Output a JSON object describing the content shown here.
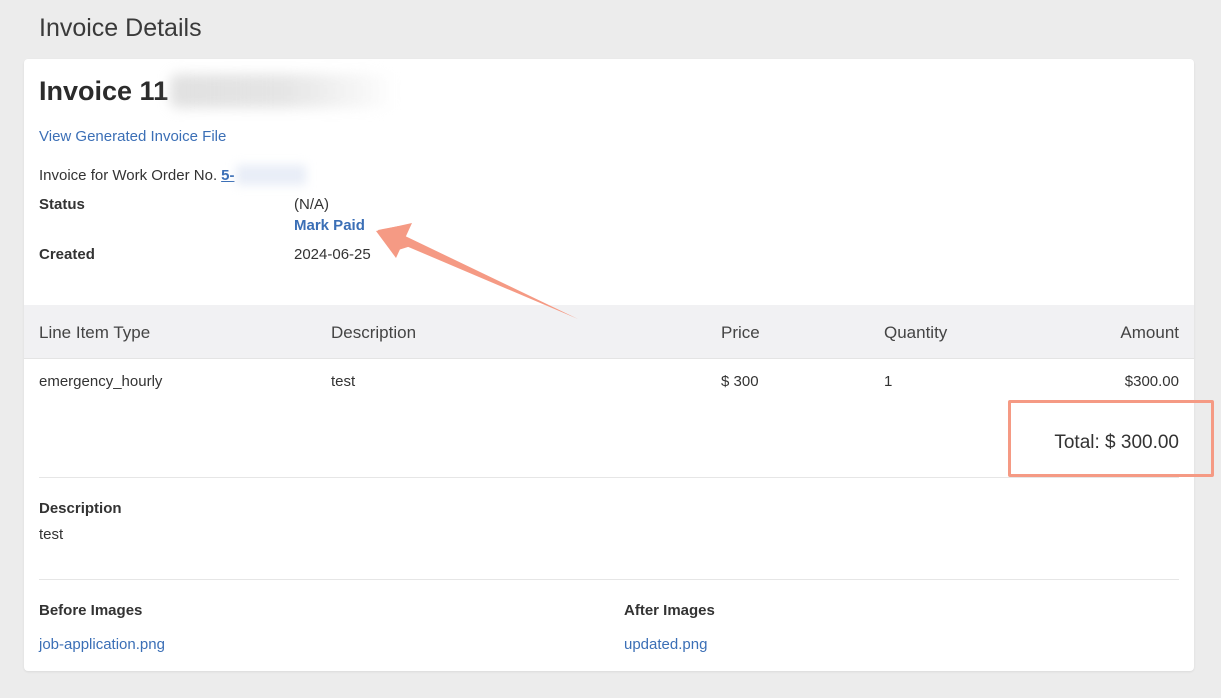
{
  "page": {
    "title": "Invoice Details"
  },
  "invoice": {
    "title": "Invoice 11",
    "view_file_link": "View Generated Invoice File",
    "work_order_label": "Invoice for Work Order No.",
    "work_order_number": "5-",
    "status_label": "Status",
    "status_value": "(N/A)",
    "mark_paid_label": "Mark Paid",
    "created_label": "Created",
    "created_value": "2024-06-25"
  },
  "line_items": {
    "headers": [
      "Line Item Type",
      "Description",
      "Price",
      "Quantity",
      "Amount"
    ],
    "rows": [
      {
        "type": "emergency_hourly",
        "description": "test",
        "price": "$ 300",
        "quantity": "1",
        "amount": "$300.00"
      }
    ],
    "total": "Total: $ 300.00"
  },
  "description": {
    "label": "Description",
    "value": "test"
  },
  "images": {
    "before_label": "Before Images",
    "before_file": "job-application.png",
    "after_label": "After Images",
    "after_file": "updated.png"
  },
  "annotations": {
    "highlight_color": "#f59a84"
  }
}
